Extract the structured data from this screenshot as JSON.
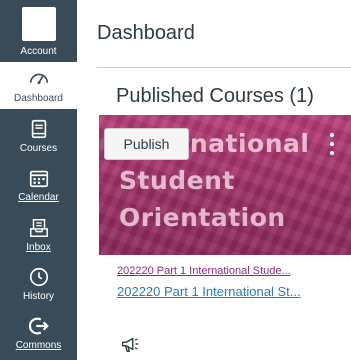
{
  "nav": {
    "account": {
      "label": "Account"
    },
    "dashboard": {
      "label": "Dashboard"
    },
    "courses": {
      "label": "Courses"
    },
    "calendar": {
      "label": "Calendar"
    },
    "inbox": {
      "label": "Inbox"
    },
    "history": {
      "label": "History"
    },
    "commons": {
      "label": "Commons"
    }
  },
  "main": {
    "title": "Dashboard",
    "section_title": "Published Courses (1)"
  },
  "course": {
    "hero_lines": [
      "International",
      "Student",
      "Orientation"
    ],
    "publish_label": "Publish",
    "link_primary": "202220 Part 1 International Stude...",
    "link_secondary": "202220 Part 1 International St..."
  },
  "colors": {
    "nav_bg": "#394b58",
    "card_color": "#a4326a",
    "link_blue": "#2b7abc"
  }
}
